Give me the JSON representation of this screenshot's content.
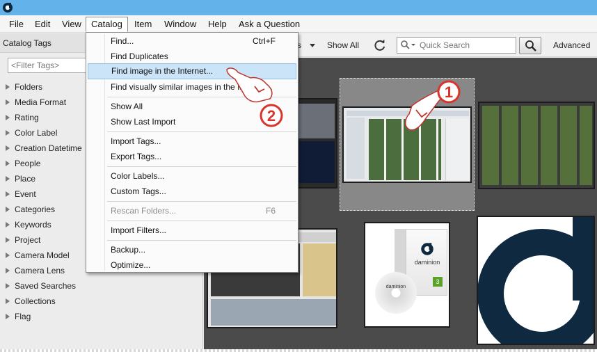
{
  "menubar": {
    "items": [
      "File",
      "Edit",
      "View",
      "Catalog",
      "Item",
      "Window",
      "Help",
      "Ask a Question"
    ]
  },
  "left_panel": {
    "title": "Catalog Tags",
    "filter_placeholder": "<Filter Tags>",
    "tree": [
      "Folders",
      "Media Format",
      "Rating",
      "Color Label",
      "Creation Datetime",
      "People",
      "Place",
      "Event",
      "Categories",
      "Keywords",
      "Project",
      "Camera Model",
      "Camera Lens",
      "Saved Searches",
      "Collections",
      "Flag"
    ]
  },
  "toolbar": {
    "partial_label": "s",
    "show_all": "Show All",
    "quick_search_placeholder": "Quick Search",
    "advanced": "Advanced"
  },
  "catalog_menu": {
    "find": "Find...",
    "find_shortcut": "Ctrl+F",
    "find_duplicates": "Find Duplicates",
    "find_internet": "Find image in the Internet...",
    "find_similar": "Find visually similar images in the Internet...",
    "show_all": "Show All",
    "show_last_import": "Show Last Import",
    "import_tags": "Import Tags...",
    "export_tags": "Export Tags...",
    "color_labels": "Color Labels...",
    "custom_tags": "Custom Tags...",
    "rescan_folders": "Rescan Folders...",
    "rescan_shortcut": "F6",
    "import_filters": "Import Filters...",
    "backup": "Backup...",
    "optimize": "Optimize..."
  },
  "annotations": {
    "step1": "1",
    "step2": "2"
  },
  "product_box": {
    "brand": "daminion",
    "disc_label": "daminion",
    "badge": "3"
  },
  "colors": {
    "titlebar": "#63b3ea",
    "highlight": "#cce4f7",
    "gallery_bg": "#4b4b4b",
    "annotation_red": "#d9342b",
    "logo_navy": "#0e2940"
  }
}
